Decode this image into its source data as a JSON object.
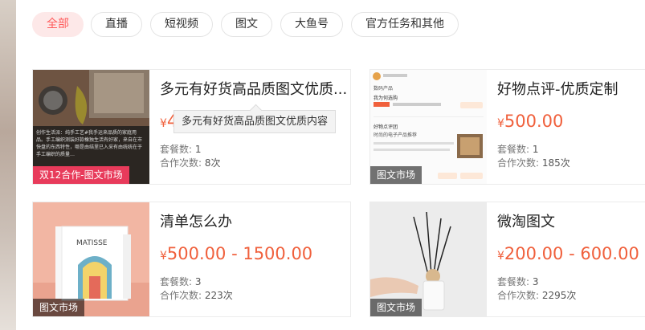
{
  "filters": [
    "全部",
    "直播",
    "短视频",
    "图文",
    "大鱼号",
    "官方任务和其他"
  ],
  "active_filter": "全部",
  "labels": {
    "packages": "套餐数:",
    "collabs": "合作次数:"
  },
  "cards": [
    {
      "title": "多元有好货高品质图文优质...",
      "price_currency": "¥",
      "price": "4",
      "packages": "1",
      "collabs": "8次",
      "badge": "双12合作-图文市场",
      "thumb_caption": "创作生活派：纯手工艺#我手运来品质的家庭用品。手工编织测装好款橡独生活有好家，来自在市快盘的东西特性，哪是由结里已入采有由统统在于手工编织的质量…"
    },
    {
      "title": "好物点评-优质定制",
      "price_currency": "¥",
      "price": "500.00",
      "packages": "1",
      "collabs": "185次",
      "badge": "图文市场",
      "thumb_lines": [
        "数码产品",
        "我为何选购",
        "好物点评团",
        "时尚的电子产品推荐"
      ]
    },
    {
      "title": "清单怎么办",
      "price_currency": "¥",
      "price": "500.00 - 1500.00",
      "packages": "3",
      "collabs": "223次",
      "badge": "图文市场",
      "thumb_book": "MATISSE"
    },
    {
      "title": "微淘图文",
      "price_currency": "¥",
      "price": "200.00 - 600.00",
      "packages": "3",
      "collabs": "2295次",
      "badge": "图文市场"
    }
  ],
  "tooltip": "多元有好货高品质图文优质内容"
}
